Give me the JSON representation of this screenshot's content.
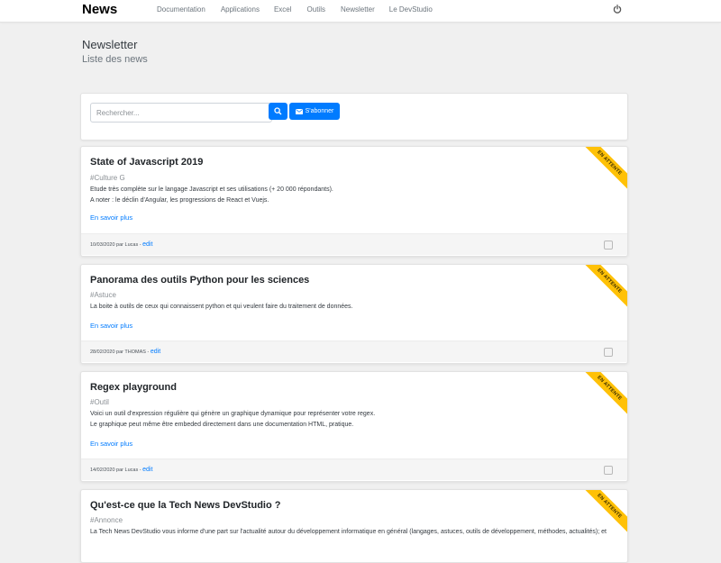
{
  "navbar": {
    "brand": "News",
    "links": [
      "Documentation",
      "Applications",
      "Excel",
      "Outils",
      "Newsletter",
      "Le DevStudio"
    ],
    "power_icon": "power-icon"
  },
  "header": {
    "title": "Newsletter",
    "subtitle": "Liste des news"
  },
  "search": {
    "placeholder": "Rechercher...",
    "search_icon": "search-icon",
    "subscribe_icon": "envelope-icon",
    "subscribe_label": "S'abonner"
  },
  "colors": {
    "accent": "#007bff",
    "ribbon": "#ffc107"
  },
  "news": [
    {
      "title": "State of Javascript 2019",
      "tag": "#Culture G",
      "body": [
        "Etude très complète sur le langage Javascript et ses utilisations (+ 20 000 répondants).",
        "A noter : le déclin d'Angular, les progressions de React et Vuejs."
      ],
      "read_more": "En savoir plus",
      "meta": "10/03/2020 par Lucas -",
      "edit": "edit",
      "ribbon": "EN ATTENTE"
    },
    {
      "title": "Panorama des outils Python pour les sciences",
      "tag": "#Astuce",
      "body": [
        "La boite à outils de ceux qui connaissent python et qui veulent faire du traitement de données."
      ],
      "read_more": "En savoir plus",
      "meta": "28/02/2020 par THOMAS -",
      "edit": "edit",
      "ribbon": "EN ATTENTE"
    },
    {
      "title": "Regex playground",
      "tag": "#Outil",
      "body": [
        "Voici un outil d'expression régulière qui génère un graphique dynamique pour représenter votre regex.",
        "Le graphique peut même être embeded directement dans une documentation HTML, pratique."
      ],
      "read_more": "En savoir plus",
      "meta": "14/02/2020 par Lucas -",
      "edit": "edit",
      "ribbon": "EN ATTENTE"
    },
    {
      "title": "Qu'est-ce que la Tech News DevStudio ?",
      "tag": "#Annonce",
      "body": [
        "La Tech News DevStudio vous informe d'une part sur l'actualité autour du développement informatique en général (langages, astuces, outils de développement, méthodes, actualités); et"
      ],
      "ribbon": "EN ATTENTE"
    }
  ]
}
